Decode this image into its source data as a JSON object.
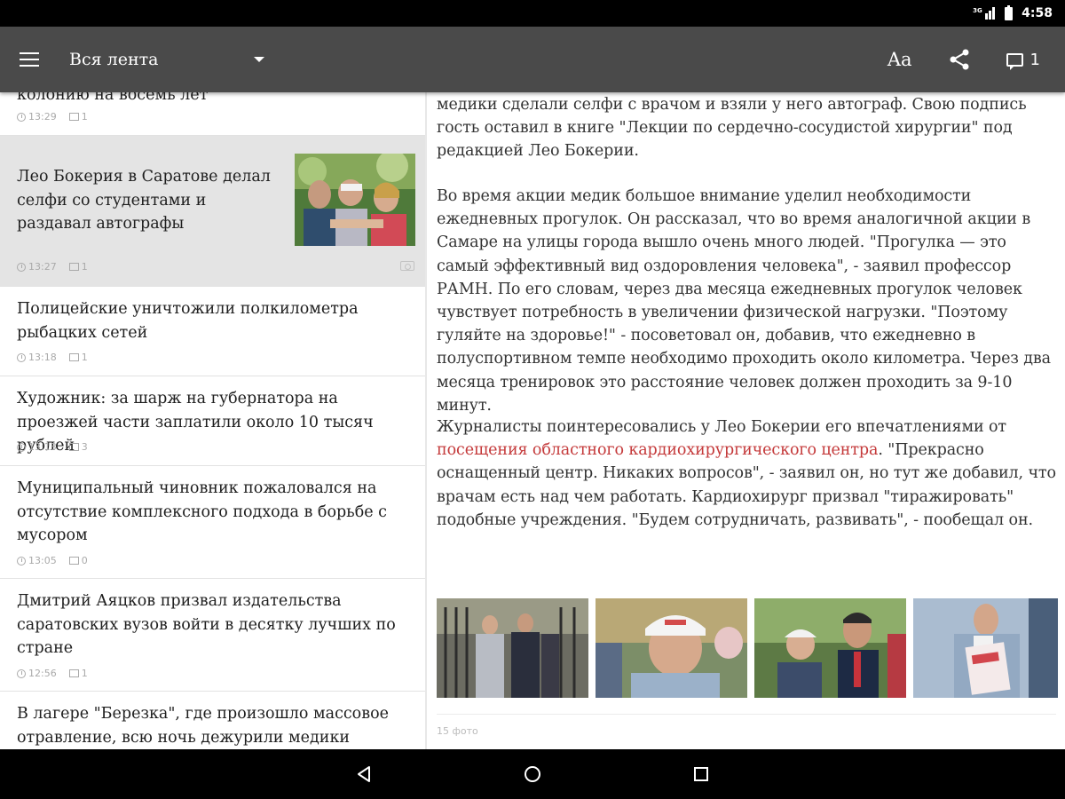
{
  "status": {
    "network": "3G",
    "time": "4:58"
  },
  "toolbar": {
    "feed_label": "Вся лента",
    "font_label": "Aa",
    "comments_count": "1"
  },
  "list": [
    {
      "title": "колонию на восемь лет",
      "time": "13:29",
      "comments": "1"
    },
    {
      "title": "Лео Бокерия в Саратове делал селфи со студентами и раздавал автографы",
      "time": "13:27",
      "comments": "1",
      "selected": true,
      "has_photo": true
    },
    {
      "title": "Полицейские уничтожили полкилометра рыбацких сетей",
      "time": "13:18",
      "comments": "1"
    },
    {
      "title": "Художник: за шарж на губернатора на проезжей части заплатили около 10 тысяч рублей",
      "time": "13:13",
      "comments": "3"
    },
    {
      "title": "Муниципальный чиновник пожаловался на отсутствие комплексного подхода в борьбе с мусором",
      "time": "13:05",
      "comments": "0"
    },
    {
      "title": "Дмитрий Аяцков призвал издательства саратовских вузов войти в десятку лучших по стране",
      "time": "12:56",
      "comments": "1"
    },
    {
      "title": "В лагере \"Березка\", где произошло массовое отравление, всю ночь дежурили медики",
      "time": "",
      "comments": ""
    }
  ],
  "article": {
    "p1": "медики сделали селфи с врачом и взяли у него автограф. Свою подпись гость оставил в книге \"Лекции по сердечно-сосудистой хирургии\" под редакцией Лео Бокерии.",
    "p2": "Во время акции медик большое внимание уделил необходимости ежедневных прогулок. Он рассказал, что во время аналогичной акции в Самаре на улицы города вышло очень много людей. \"Прогулка — это самый эффективный вид оздоровления человека\", - заявил профессор РАМН. По его словам, через два месяца ежедневных прогулок человек чувствует потребность в увеличении физической нагрузки. \"Поэтому гуляйте на здоровье!\" - посоветовал он, добавив, что ежедневно в полуспортивном темпе необходимо проходить около километра. Через два месяца тренировок это расстояние человек должен проходить за 9-10 минут.",
    "p3_before": "Журналисты поинтересовались у Лео Бокерии его впечатлениями от ",
    "p3_link": "посещения областного кардиохирургического центра",
    "p3_after": ". \"Прекрасно оснащенный центр. Никаких вопросов\", - заявил он, но тут же добавил, что врачам есть над чем работать. Кардиохирург призвал \"тиражировать\" подобные учреждения. \"Будем сотрудничать, развивать\", - пообещал он.",
    "photo_count": "15 фото"
  },
  "colors": {
    "toolbar": "#4a4a4a",
    "selected_row": "#e4e4e4",
    "link": "#c4393a"
  }
}
